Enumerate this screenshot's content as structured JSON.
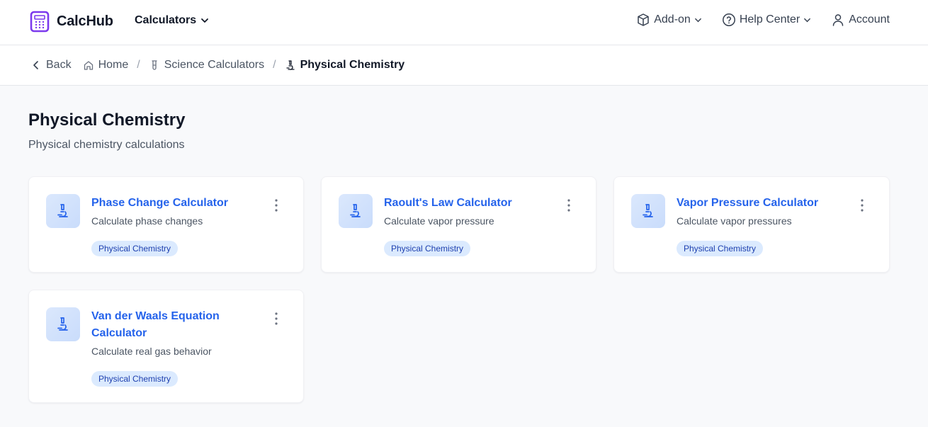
{
  "brand": {
    "name": "CalcHub",
    "accent": "#7c3aed"
  },
  "nav": {
    "calculators_label": "Calculators",
    "addon_label": "Add-on",
    "help_label": "Help Center",
    "account_label": "Account"
  },
  "breadcrumb": {
    "back_label": "Back",
    "home_label": "Home",
    "science_label": "Science Calculators",
    "current_label": "Physical Chemistry"
  },
  "page": {
    "title": "Physical Chemistry",
    "subtitle": "Physical chemistry calculations"
  },
  "cards": [
    {
      "title": "Phase Change Calculator",
      "description": "Calculate phase changes",
      "tag": "Physical Chemistry",
      "icon": "microscope-icon"
    },
    {
      "title": "Raoult's Law Calculator",
      "description": "Calculate vapor pressure",
      "tag": "Physical Chemistry",
      "icon": "microscope-icon"
    },
    {
      "title": "Vapor Pressure Calculator",
      "description": "Calculate vapor pressures",
      "tag": "Physical Chemistry",
      "icon": "microscope-icon"
    },
    {
      "title": "Van der Waals Equation Calculator",
      "description": "Calculate real gas behavior",
      "tag": "Physical Chemistry",
      "icon": "microscope-icon"
    }
  ],
  "colors": {
    "link": "#2563eb",
    "tag_bg": "#dbeafe",
    "tag_text": "#1e40af"
  }
}
